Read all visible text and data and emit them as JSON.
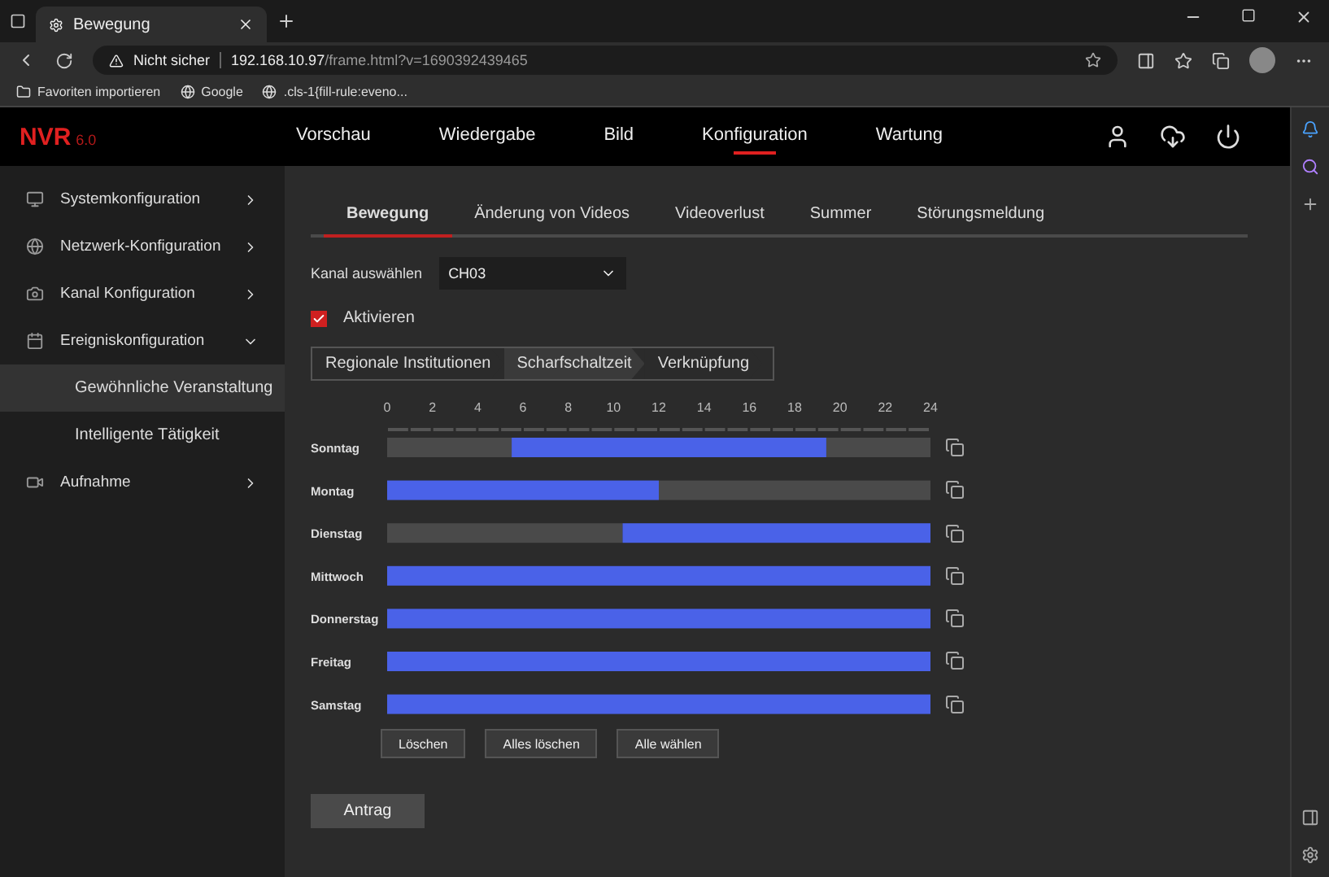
{
  "browser": {
    "tab_title": "Bewegung",
    "security": "Nicht sicher",
    "url_host": "192.168.10.97",
    "url_path": "/frame.html?v=1690392439465",
    "bookmarks": [
      "Favoriten importieren",
      "Google",
      ".cls-1{fill-rule:eveno..."
    ]
  },
  "app": {
    "logo": "NVR",
    "version": "6.0",
    "nav": [
      {
        "label": "Vorschau",
        "selected": false
      },
      {
        "label": "Wiedergabe",
        "selected": false
      },
      {
        "label": "Bild",
        "selected": false
      },
      {
        "label": "Konfiguration",
        "selected": true
      },
      {
        "label": "Wartung",
        "selected": false
      }
    ]
  },
  "sidebar": {
    "items": [
      {
        "label": "Systemkonfiguration",
        "expanded": false
      },
      {
        "label": "Netzwerk-Konfiguration",
        "expanded": false
      },
      {
        "label": "Kanal Konfiguration",
        "expanded": false
      },
      {
        "label": "Ereigniskonfiguration",
        "expanded": true,
        "children": [
          {
            "label": "Gewöhnliche Veranstaltung",
            "selected": true
          },
          {
            "label": "Intelligente Tätigkeit",
            "selected": false
          }
        ]
      },
      {
        "label": "Aufnahme",
        "expanded": false
      }
    ]
  },
  "tabs": [
    {
      "label": "Bewegung",
      "selected": true
    },
    {
      "label": "Änderung von Videos",
      "selected": false
    },
    {
      "label": "Videoverlust",
      "selected": false
    },
    {
      "label": "Summer",
      "selected": false
    },
    {
      "label": "Störungsmeldung",
      "selected": false
    }
  ],
  "channel": {
    "label": "Kanal auswählen",
    "value": "CH03"
  },
  "enable": {
    "label": "Aktivieren",
    "checked": true
  },
  "steps": [
    {
      "label": "Regionale Institutionen",
      "selected": false
    },
    {
      "label": "Scharfschaltzeit",
      "selected": true
    },
    {
      "label": "Verknüpfung",
      "selected": false
    }
  ],
  "schedule": {
    "chart_data": {
      "type": "bar",
      "orientation": "horizontal",
      "stacked": true,
      "categories": [
        "Sonntag",
        "Montag",
        "Dienstag",
        "Mittwoch",
        "Donnerstag",
        "Freitag",
        "Samstag"
      ],
      "series": [
        {
          "color": "#4a4a4a",
          "values": [
            5.5,
            0,
            10.4,
            0,
            0,
            0,
            0
          ]
        },
        {
          "color": "#4a62e8",
          "values": [
            13.9,
            12,
            13.6,
            24,
            24,
            24,
            24
          ]
        },
        {
          "color": "#4a4a4a",
          "values": [
            4.6,
            12,
            0,
            0,
            0,
            0,
            0
          ]
        }
      ],
      "xlim": [
        0,
        24
      ],
      "xticks": [
        0,
        2,
        4,
        6,
        8,
        10,
        12,
        14,
        16,
        18,
        20,
        22,
        24
      ]
    }
  },
  "schedule_buttons": [
    "Löschen",
    "Alles löschen",
    "Alle wählen"
  ],
  "submit": "Antrag"
}
